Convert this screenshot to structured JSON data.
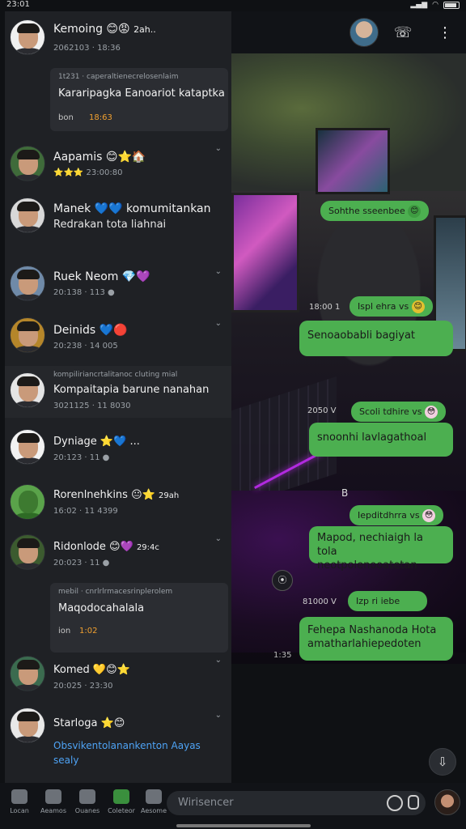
{
  "status": {
    "time": "23:01"
  },
  "header": {
    "arrow": "◂▸"
  },
  "chats": [
    {
      "name": "Kemoing",
      "emojis": "😊😡",
      "extra": "2ah..",
      "sub": "2062103 · 18:36",
      "unread": ""
    },
    {
      "card_head": "1t231 · caperaltienecrelosenlaim",
      "card_body": "Kararipagka Eanoariot kataptka",
      "card_foot": "bon",
      "card_time": "18:63"
    },
    {
      "name": "Aapamis",
      "emojis": "😊⭐🏠",
      "sub": "⭐⭐⭐ 23:00:80"
    },
    {
      "name": "Manek",
      "emojis": "💙💙",
      "extra": "komumitankan",
      "preview": "Redrakan tota liahnai"
    },
    {
      "name": "Ruek Neom",
      "emojis": "💎💜",
      "sub": "20:138 · 113 ●"
    },
    {
      "name": "Deinids",
      "emojis": "💙🔴",
      "sub": "20:238 · 14 005"
    },
    {
      "name": "Kompaitapia barune nanahan",
      "top": "kompiliriancrtalitanoc cluting mial",
      "sub": "3021125 · 11 8030"
    },
    {
      "name": "Dyniage",
      "emojis": "⭐💙",
      "extra": "...",
      "sub": "20:123 · 11 ●"
    },
    {
      "name": "Rorenlnehkins",
      "emojis": "😐⭐",
      "extra": "29ah",
      "sub": "16:02 · 11 4399"
    },
    {
      "name": "Ridonlode",
      "emojis": "😊💜",
      "extra": "29:4c",
      "sub": "20:023 · 11 ●"
    },
    {
      "card_head": "mebil · cnrlrlrmacesrinplerolem",
      "card_body": "Maqodocahalala",
      "card_foot": "ion",
      "card_time": "1:02"
    },
    {
      "name": "Komed",
      "emojis": "💛😊⭐",
      "sub": "20:025 · 23:30"
    },
    {
      "name": "Starloga",
      "emojis": "⭐😊",
      "preview": "Obsvikentolanankenton Aayas",
      "preview2": "sealy"
    }
  ],
  "messages": [
    {
      "text": "Sohthe sseenbee",
      "emoji": "😊",
      "type": "small"
    },
    {
      "meta": "18:00 1",
      "text": "Ispl ehra vs",
      "emoji": "😊",
      "type": "small"
    },
    {
      "text": "Senoaobabli bagiyat",
      "type": "big"
    },
    {
      "meta": "2050 V",
      "text": "Scoli tdhire vs",
      "emoji": "😳",
      "type": "small"
    },
    {
      "text": "snoonhi lavlagathoal",
      "type": "big"
    },
    {
      "text": "Iepditdhrra vs",
      "emoji": "😳",
      "type": "small"
    },
    {
      "text": "Mapod, nechiaigh la tola",
      "text2": "neotpolenooatetan",
      "type": "big"
    },
    {
      "meta": "81000 V",
      "text": "Izp ri iebe",
      "type": "small"
    },
    {
      "text": "Fehepa Nashanoda Hota",
      "text2": "amatharlahiepedoten",
      "type": "big"
    }
  ],
  "scene_labels": {
    "b": "B",
    "photo_time": "1:35"
  },
  "bottom_nav": [
    {
      "label": "Locan",
      "icon": "home-icon"
    },
    {
      "label": "Aeamos",
      "icon": "game-icon"
    },
    {
      "label": "Ouanes",
      "icon": "chat-icon"
    },
    {
      "label": "Coleteor",
      "icon": "status-icon"
    },
    {
      "label": "Aesome",
      "icon": "people-icon"
    }
  ],
  "composer": {
    "placeholder": "Wirisencer"
  },
  "colors": {
    "bubble": "#4caf50",
    "panel": "#1f2125",
    "accent": "#2196f3"
  }
}
